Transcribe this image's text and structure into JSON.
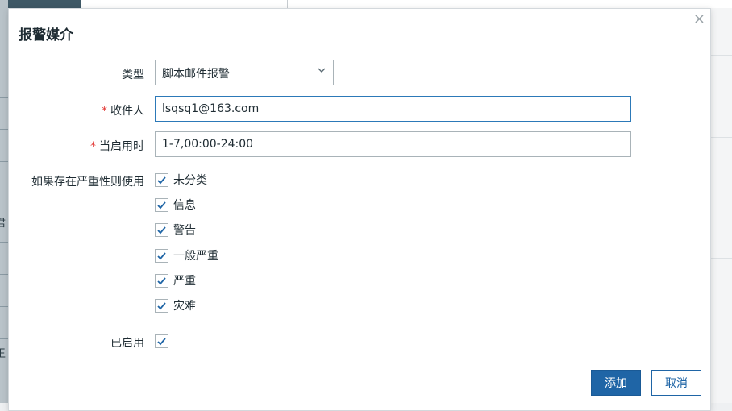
{
  "background": {
    "side_text_1": "君",
    "side_text_2": "王"
  },
  "dialog": {
    "title": "报警媒介",
    "close_symbol": "×",
    "type": {
      "label": "类型",
      "value": "脚本邮件报警"
    },
    "recipient": {
      "label": "收件人",
      "value": "lsqsq1@163.com"
    },
    "when_active": {
      "label": "当启用时",
      "value": "1-7,00:00-24:00"
    },
    "severity": {
      "label": "如果存在严重性则使用",
      "options": [
        {
          "label": "未分类",
          "checked": true
        },
        {
          "label": "信息",
          "checked": true
        },
        {
          "label": "警告",
          "checked": true
        },
        {
          "label": "一般严重",
          "checked": true
        },
        {
          "label": "严重",
          "checked": true
        },
        {
          "label": "灾难",
          "checked": true
        }
      ]
    },
    "enabled": {
      "label": "已启用",
      "checked": true
    },
    "required_mark": "*",
    "add_button": "添加",
    "cancel_button": "取消"
  },
  "colors": {
    "primary": "#1f65a6",
    "required": "#e33734",
    "focus_border": "#2c79b8",
    "check": "#1f65a6"
  }
}
